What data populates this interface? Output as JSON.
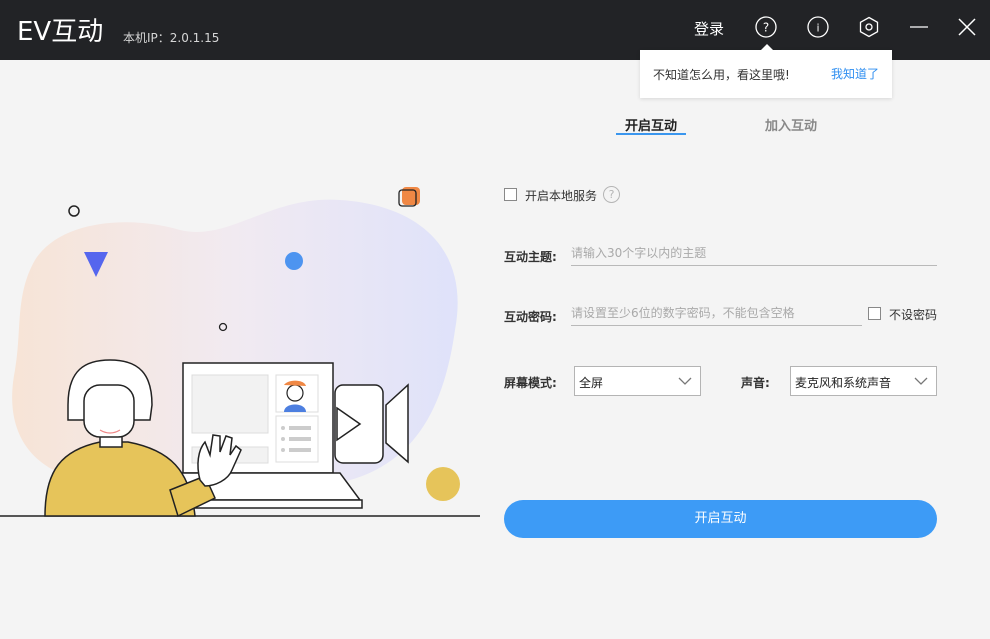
{
  "titlebar": {
    "app_title": "EV互动",
    "ip_label": "本机IP：2.0.1.15",
    "login_label": "登录",
    "icons": [
      "help-icon",
      "info-icon",
      "settings-icon",
      "minimize-icon",
      "close-icon"
    ]
  },
  "tooltip": {
    "text": "不知道怎么用，看这里哦!",
    "dismiss_label": "我知道了"
  },
  "tabs": [
    {
      "label": "开启互动",
      "active": true
    },
    {
      "label": "加入互动",
      "active": false
    }
  ],
  "form": {
    "local_service_label": "开启本地服务",
    "local_service_help": "?",
    "topic_label": "互动主题:",
    "topic_placeholder": "请输入30个字以内的主题",
    "password_label": "互动密码:",
    "password_placeholder": "请设置至少6位的数字密码，不能包含空格",
    "no_password_label": "不设密码",
    "screen_mode_label": "屏幕模式:",
    "screen_mode_value": "全屏",
    "audio_label": "声音:",
    "audio_value": "麦克风和系统声音",
    "submit_label": "开启互动"
  },
  "colors": {
    "titlebar_bg": "#222326",
    "accent": "#3d9bf6",
    "link": "#2e8ef0",
    "page_bg": "#f4f4f4"
  }
}
